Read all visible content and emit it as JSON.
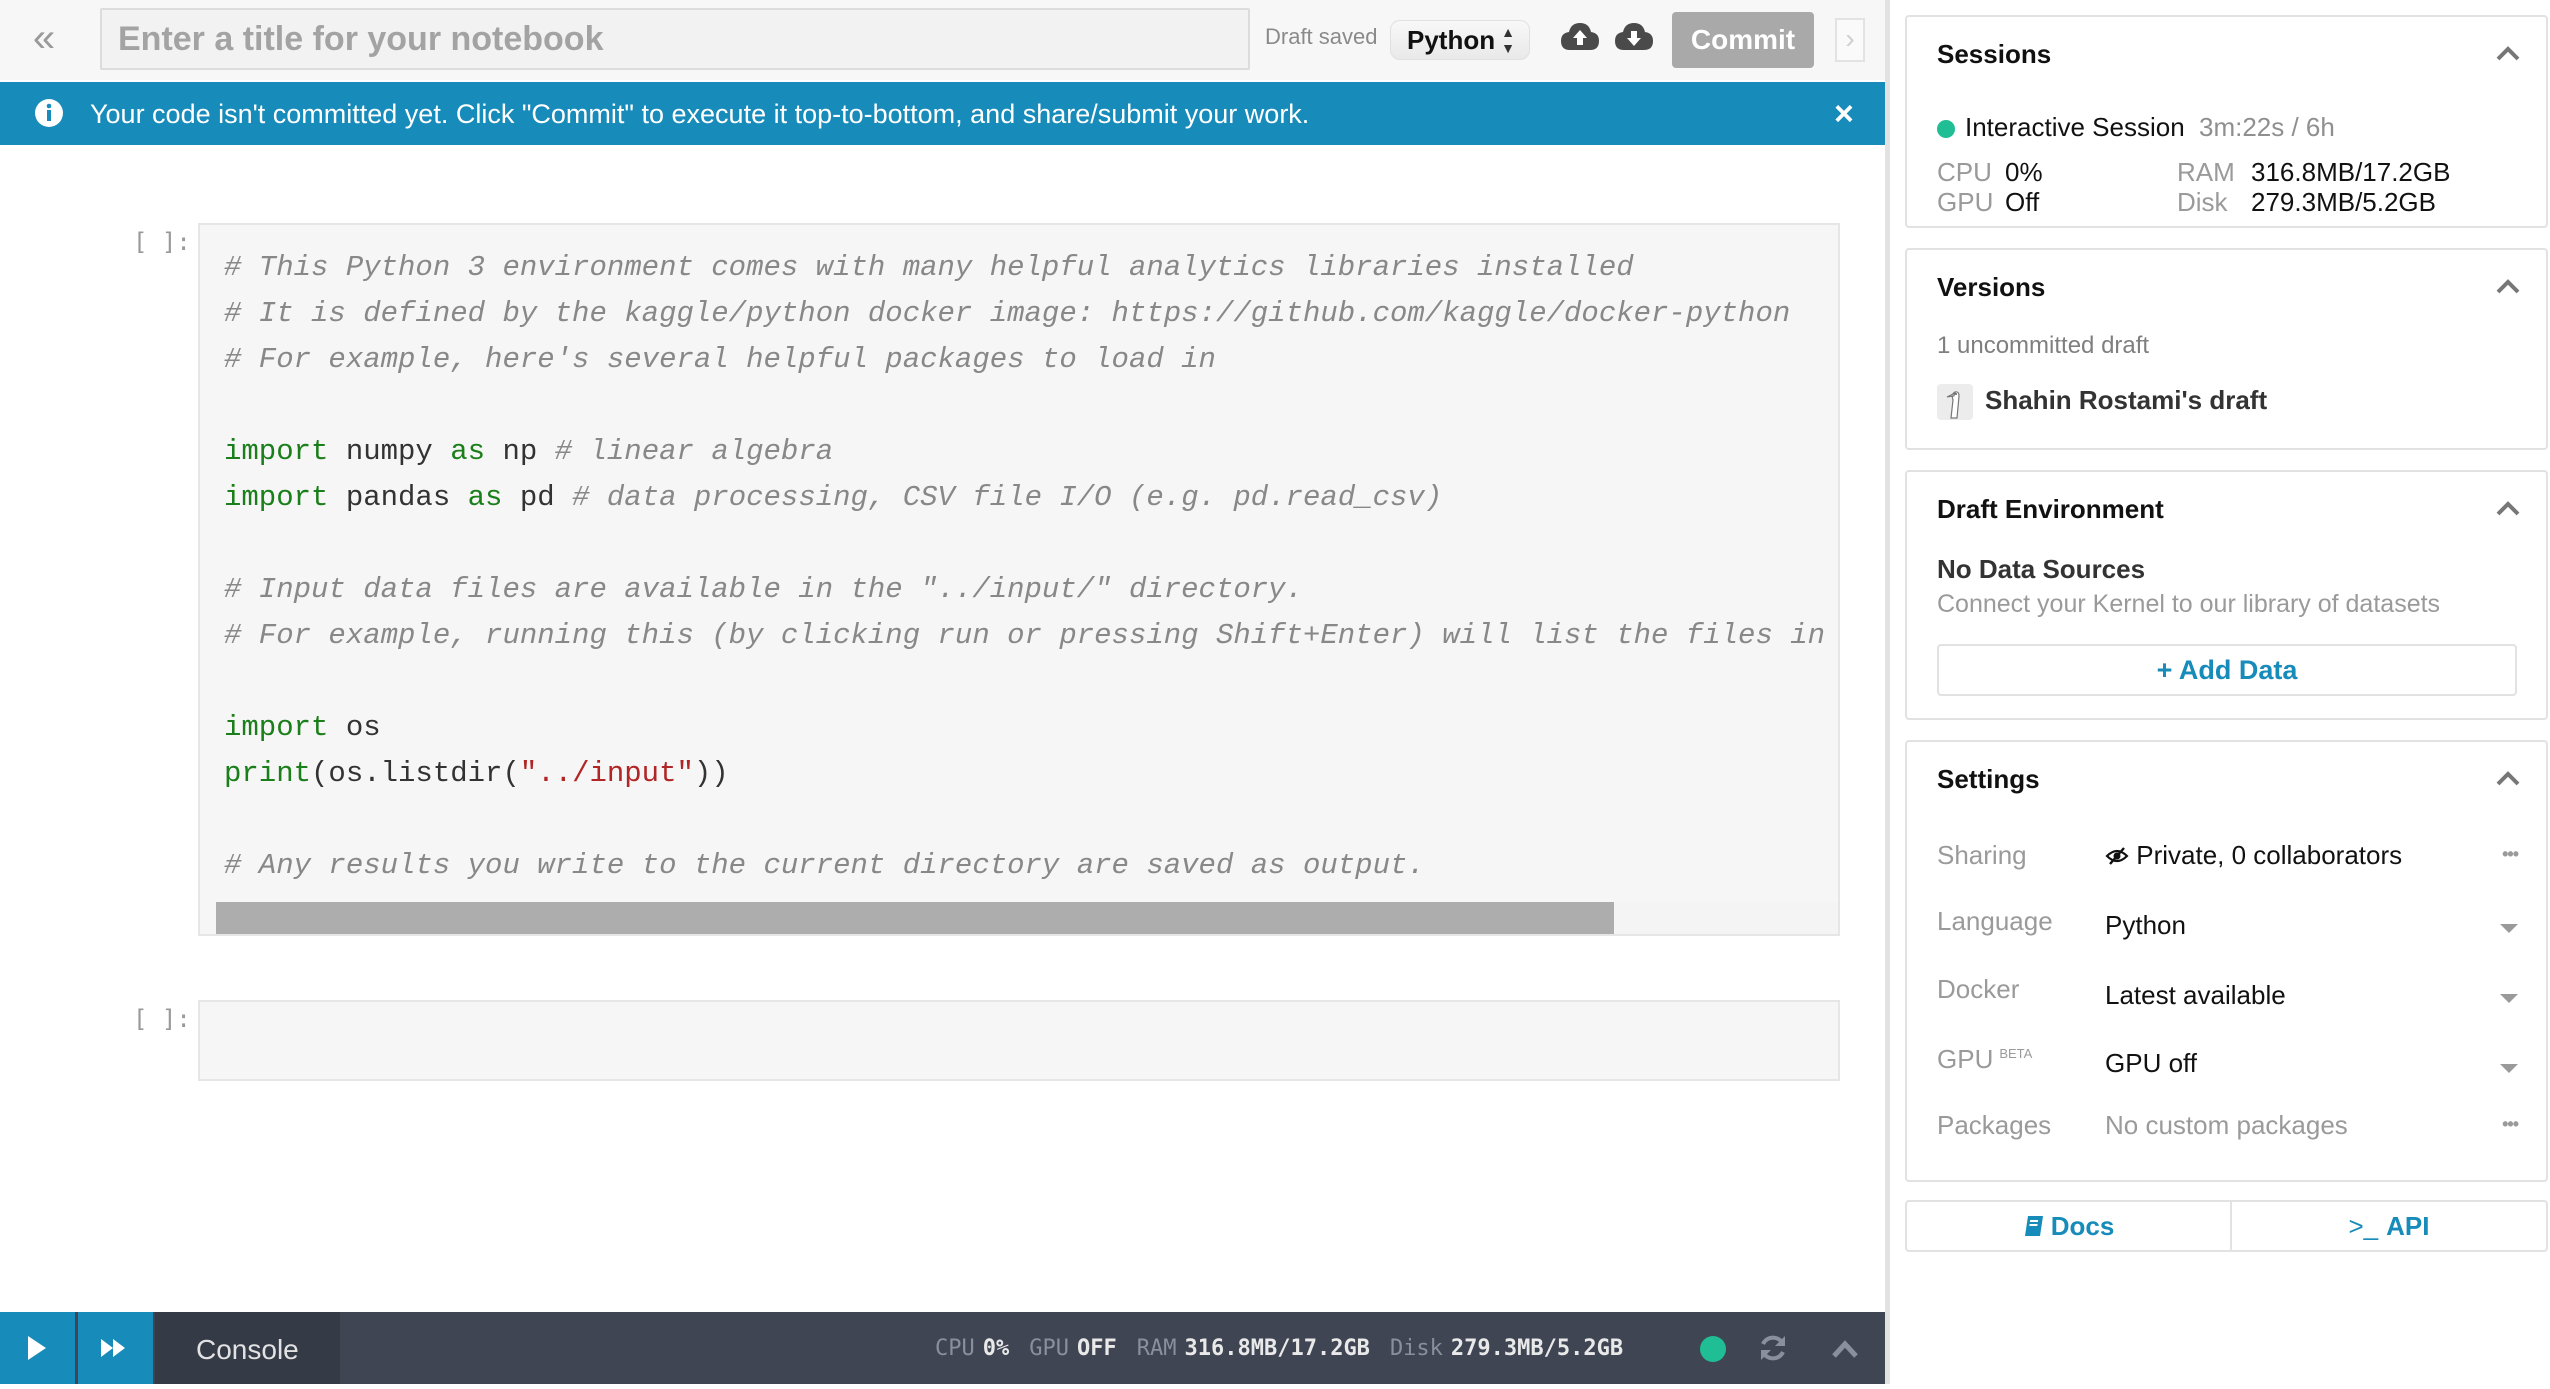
{
  "topbar": {
    "collapse_icon": "double-chevron-left-icon",
    "title_placeholder": "Enter a title for your notebook",
    "title_value": "",
    "draft_status": "Draft saved",
    "language_selected": "Python",
    "upload_icon": "cloud-upload-icon",
    "download_icon": "cloud-download-icon",
    "commit_label": "Commit",
    "expand_icon": "chevron-right-icon"
  },
  "banner": {
    "icon": "info-icon",
    "text": "Your code isn't committed yet. Click \"Commit\" to execute it top-to-bottom, and share/submit your work.",
    "close": "×"
  },
  "cells": [
    {
      "prompt": "[ ]:",
      "lines": [
        [
          {
            "t": "# This Python 3 environment comes with many helpful analytics libraries installed",
            "c": "cm"
          }
        ],
        [
          {
            "t": "# It is defined by the kaggle/python docker image: https://github.com/kaggle/docker-python",
            "c": "cm"
          }
        ],
        [
          {
            "t": "# For example, here's several helpful packages to load in",
            "c": "cm"
          }
        ],
        [],
        [
          {
            "t": "import",
            "c": "kw"
          },
          {
            "t": " numpy ",
            "c": ""
          },
          {
            "t": "as",
            "c": "kw"
          },
          {
            "t": " np ",
            "c": ""
          },
          {
            "t": "# linear algebra",
            "c": "cm"
          }
        ],
        [
          {
            "t": "import",
            "c": "kw"
          },
          {
            "t": " pandas ",
            "c": ""
          },
          {
            "t": "as",
            "c": "kw"
          },
          {
            "t": " pd ",
            "c": ""
          },
          {
            "t": "# data processing, CSV file I/O (e.g. pd.read_csv)",
            "c": "cm"
          }
        ],
        [],
        [
          {
            "t": "# Input data files are available in the \"../input/\" directory.",
            "c": "cm"
          }
        ],
        [
          {
            "t": "# For example, running this (by clicking run or pressing Shift+Enter) will list the files in the input directory",
            "c": "cm"
          }
        ],
        [],
        [
          {
            "t": "import",
            "c": "kw"
          },
          {
            "t": " os",
            "c": ""
          }
        ],
        [
          {
            "t": "print",
            "c": "kw"
          },
          {
            "t": "(os.listdir(",
            "c": ""
          },
          {
            "t": "\"../input\"",
            "c": "st"
          },
          {
            "t": "))",
            "c": ""
          }
        ],
        [],
        [
          {
            "t": "# Any results you write to the current directory are saved as output.",
            "c": "cm"
          }
        ]
      ]
    },
    {
      "prompt": "[ ]:",
      "lines": []
    }
  ],
  "bottombar": {
    "run_icon": "play-icon",
    "run_all_icon": "fast-forward-icon",
    "console_label": "Console",
    "cpu_label": "CPU",
    "cpu_value": "0%",
    "gpu_label": "GPU",
    "gpu_value": "OFF",
    "ram_label": "RAM",
    "ram_value": "316.8MB/17.2GB",
    "disk_label": "Disk",
    "disk_value": "279.3MB/5.2GB",
    "status_color": "#20be94"
  },
  "panel": {
    "sessions": {
      "title": "Sessions",
      "session_name": "Interactive Session",
      "session_time": "3m:22s / 6h",
      "cpu_label": "CPU",
      "cpu_value": "0%",
      "gpu_label": "GPU",
      "gpu_value": "Off",
      "ram_label": "RAM",
      "ram_value": "316.8MB/17.2GB",
      "disk_label": "Disk",
      "disk_value": "279.3MB/5.2GB"
    },
    "versions": {
      "title": "Versions",
      "uncommitted": "1 uncommitted draft",
      "draft_name": "Shahin Rostami's draft"
    },
    "environment": {
      "title": "Draft Environment",
      "no_data": "No Data Sources",
      "connect_text": "Connect your Kernel to our library of datasets",
      "add_data_label": "+ Add Data"
    },
    "settings": {
      "title": "Settings",
      "rows": [
        {
          "label": "Sharing",
          "value": "Private, 0 collaborators",
          "action": "more"
        },
        {
          "label": "Language",
          "value": "Python",
          "action": "dropdown"
        },
        {
          "label": "Docker",
          "value": "Latest available",
          "action": "dropdown"
        },
        {
          "label": "GPU",
          "badge": "BETA",
          "value": "GPU off",
          "action": "dropdown"
        },
        {
          "label": "Packages",
          "value": "No custom packages",
          "action": "more"
        }
      ]
    },
    "links": {
      "docs_label": "Docs",
      "api_label": "API",
      "api_prefix": ">_"
    }
  },
  "colors": {
    "accent": "#178bb9",
    "status_green": "#20be94",
    "console_bg": "#3f4552",
    "commit_disabled": "#a9a9a9",
    "keyword": "#1a7f1a",
    "string": "#b02525",
    "comment": "#888888"
  }
}
